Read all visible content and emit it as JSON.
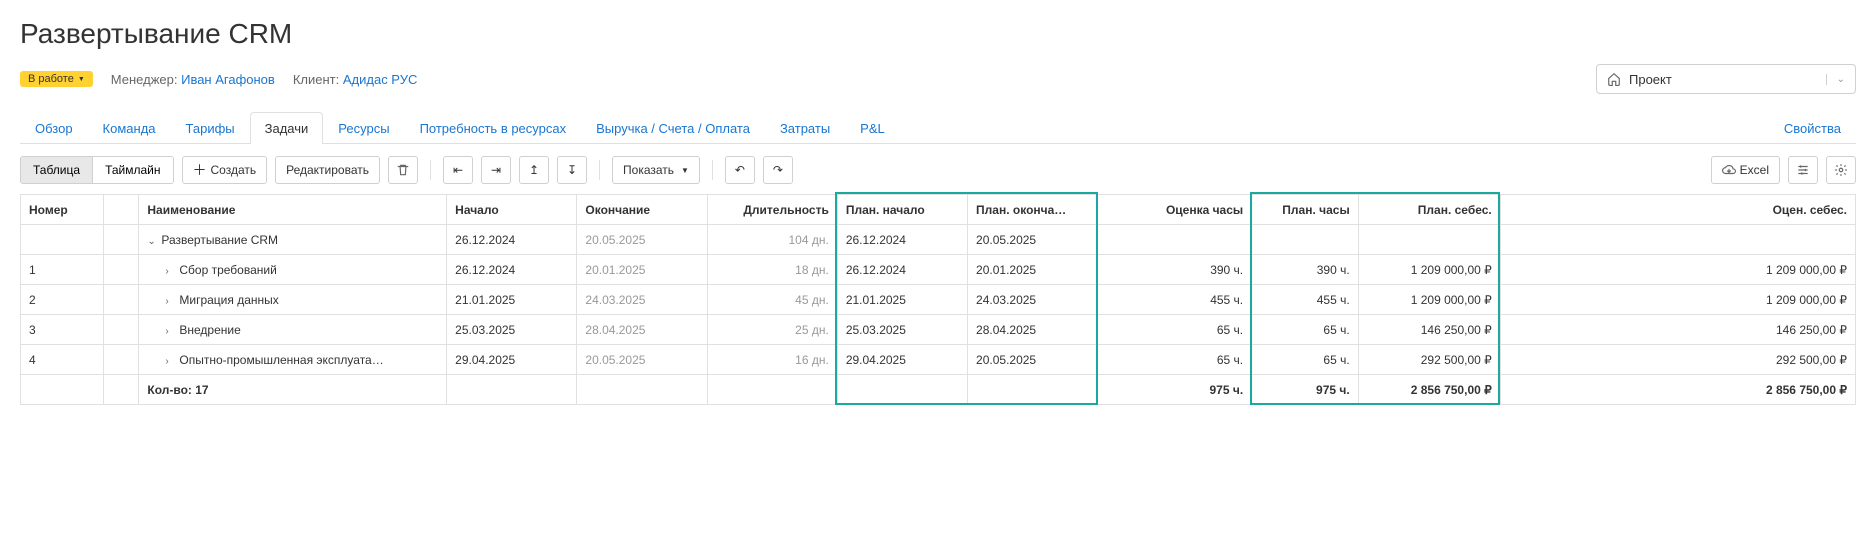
{
  "title": "Развертывание CRM",
  "status": "В работе",
  "meta": {
    "manager_label": "Менеджер:",
    "manager_name": "Иван Агафонов",
    "client_label": "Клиент:",
    "client_name": "Адидас РУС"
  },
  "project_selector": "Проект",
  "tabs": [
    "Обзор",
    "Команда",
    "Тарифы",
    "Задачи",
    "Ресурсы",
    "Потребность в ресурсах",
    "Выручка / Счета / Оплата",
    "Затраты",
    "P&L"
  ],
  "tab_active": 3,
  "tab_properties": "Свойства",
  "toolbar": {
    "view_table": "Таблица",
    "view_timeline": "Таймлайн",
    "create": "Создать",
    "edit": "Редактировать",
    "show": "Показать",
    "excel": "Excel"
  },
  "columns": [
    "Номер",
    "",
    "Наименование",
    "Начало",
    "Окончание",
    "Длительность",
    "План. начало",
    "План. оконча…",
    "Оценка часы",
    "План. часы",
    "План. себес.",
    "Оцен. себес."
  ],
  "rows": [
    {
      "num": "",
      "name": "Развертывание CRM",
      "level": 0,
      "expand": "open",
      "start": "26.12.2024",
      "end": "20.05.2025",
      "dur": "104 дн.",
      "pstart": "26.12.2024",
      "pend": "20.05.2025",
      "est_h": "",
      "plan_h": "",
      "plan_cost": "",
      "est_cost": ""
    },
    {
      "num": "1",
      "name": "Сбор требований",
      "level": 1,
      "expand": "closed",
      "start": "26.12.2024",
      "end": "20.01.2025",
      "dur": "18 дн.",
      "pstart": "26.12.2024",
      "pend": "20.01.2025",
      "est_h": "390 ч.",
      "plan_h": "390 ч.",
      "plan_cost": "1 209 000,00 ₽",
      "est_cost": "1 209 000,00 ₽"
    },
    {
      "num": "2",
      "name": "Миграция данных",
      "level": 1,
      "expand": "closed",
      "start": "21.01.2025",
      "end": "24.03.2025",
      "dur": "45 дн.",
      "pstart": "21.01.2025",
      "pend": "24.03.2025",
      "est_h": "455 ч.",
      "plan_h": "455 ч.",
      "plan_cost": "1 209 000,00 ₽",
      "est_cost": "1 209 000,00 ₽"
    },
    {
      "num": "3",
      "name": "Внедрение",
      "level": 1,
      "expand": "closed",
      "start": "25.03.2025",
      "end": "28.04.2025",
      "dur": "25 дн.",
      "pstart": "25.03.2025",
      "pend": "28.04.2025",
      "est_h": "65 ч.",
      "plan_h": "65 ч.",
      "plan_cost": "146 250,00 ₽",
      "est_cost": "146 250,00 ₽"
    },
    {
      "num": "4",
      "name": "Опытно-промышленная эксплуата…",
      "level": 1,
      "expand": "closed",
      "start": "29.04.2025",
      "end": "20.05.2025",
      "dur": "16 дн.",
      "pstart": "29.04.2025",
      "pend": "20.05.2025",
      "est_h": "65 ч.",
      "plan_h": "65 ч.",
      "plan_cost": "292 500,00 ₽",
      "est_cost": "292 500,00 ₽"
    }
  ],
  "footer": {
    "count": "Кол-во: 17",
    "est_h": "975 ч.",
    "plan_h": "975 ч.",
    "plan_cost": "2 856 750,00 ₽",
    "est_cost": "2 856 750,00 ₽"
  },
  "highlight_columns": [
    [
      6,
      7
    ],
    [
      9,
      10
    ]
  ]
}
